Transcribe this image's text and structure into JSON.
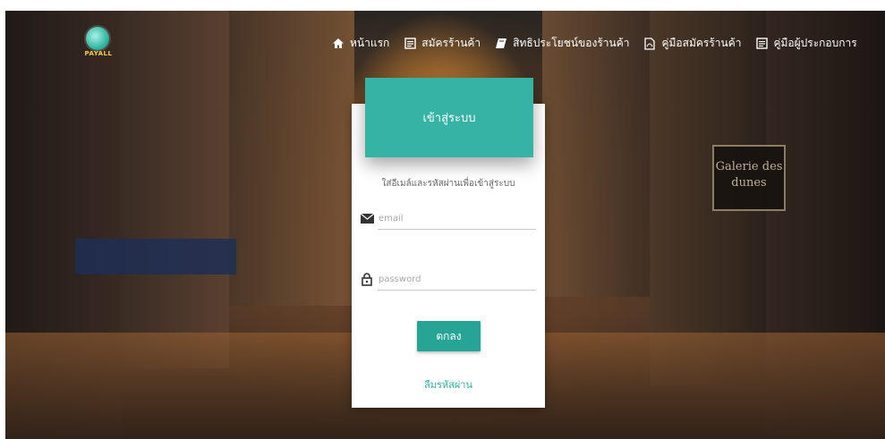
{
  "brand": {
    "logo_text": "PAYALL",
    "accent_color": "#36b3a5",
    "button_color": "#26a596"
  },
  "nav": {
    "items": [
      {
        "label": "หน้าแรก",
        "icon": "home-icon"
      },
      {
        "label": "สมัครร้านค้า",
        "icon": "form-icon"
      },
      {
        "label": "สิทธิประโยชน์ของร้านค้า",
        "icon": "book-icon"
      },
      {
        "label": "คู่มือสมัครร้านค้า",
        "icon": "pdf-icon"
      },
      {
        "label": "คู่มือผู้ประกอบการ",
        "icon": "form-icon"
      }
    ]
  },
  "login": {
    "title": "เข้าสู่ระบบ",
    "subtitle": "ใส่อีเมล์และรหัสผ่านเพื่อเข้าสู่ระบบ",
    "email": {
      "placeholder": "email",
      "value": "",
      "icon": "envelope-icon"
    },
    "password": {
      "placeholder": "password",
      "value": "",
      "icon": "lock-icon"
    },
    "submit_label": "ตกลง",
    "forgot_label": "ลืมรหัสผ่าน"
  },
  "background": {
    "sign_text": "Galerie des dunes"
  }
}
